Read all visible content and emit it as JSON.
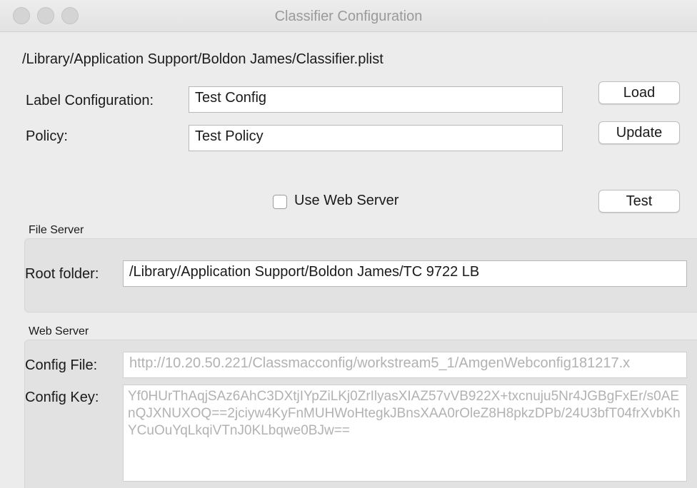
{
  "window": {
    "title": "Classifier Configuration"
  },
  "path_label": "/Library/Application Support/Boldon James/Classifier.plist",
  "label_config": {
    "label": "Label Configuration:",
    "value": "Test Config"
  },
  "policy": {
    "label": "Policy:",
    "value": "Test Policy"
  },
  "buttons": {
    "load": "Load",
    "update": "Update",
    "test": "Test"
  },
  "use_web_server": {
    "label": "Use Web Server",
    "checked": false
  },
  "file_server": {
    "caption": "File Server",
    "root_folder_label": "Root folder:",
    "root_folder_value": "/Library/Application Support/Boldon James/TC 9722 LB"
  },
  "web_server": {
    "caption": "Web Server",
    "config_file_label": "Config File:",
    "config_file_value": "http://10.20.50.221/Classmacconfig/workstream5_1/AmgenWebconfig181217.x",
    "config_key_label": "Config Key:",
    "config_key_value": "Yf0HUrThAqjSAz6AhC3DXtjIYpZiLKj0ZrIlyasXIAZ57vVB922X+txcnuju5Nr4JGBgFxEr/s0AEnQJXNUXOQ==2jciyw4KyFnMUHWoHtegkJBnsXAA0rOleZ8H8pkzDPb/24U3bfT04frXvbKhYCuOuYqLkqiVTnJ0KLbqwe0BJw=="
  },
  "colors": {
    "window_bg": "#ececec",
    "disabled_text": "#b2b2b2",
    "group_bg": "#e2e2e2"
  }
}
